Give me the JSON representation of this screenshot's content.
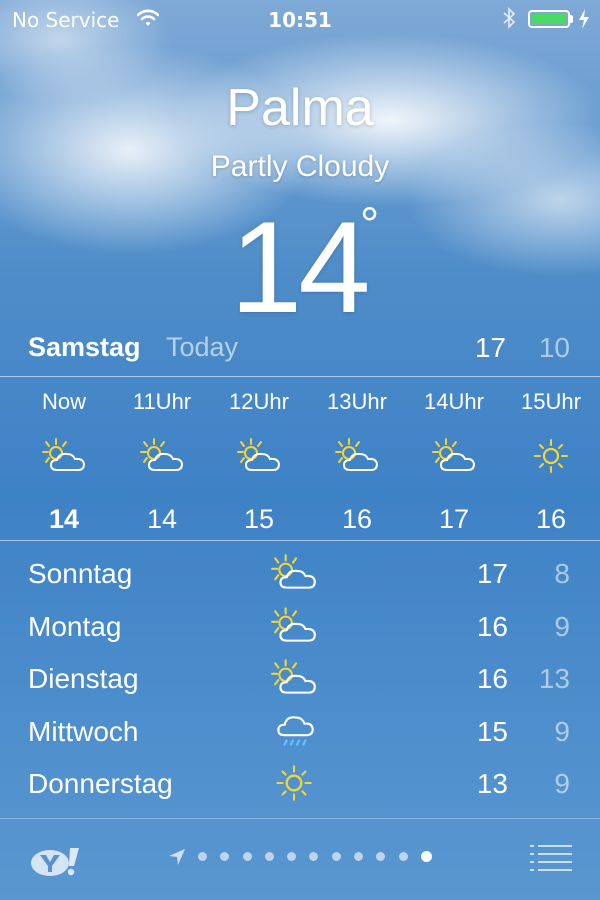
{
  "status_bar": {
    "carrier": "No Service",
    "time": "10:51"
  },
  "header": {
    "city": "Palma",
    "condition": "Partly Cloudy",
    "temperature": "14",
    "degree": "°"
  },
  "today": {
    "day": "Samstag",
    "label": "Today",
    "high": "17",
    "low": "10"
  },
  "hourly": [
    {
      "label": "Now",
      "icon": "partly-cloudy-icon",
      "temp": "14"
    },
    {
      "label": "11Uhr",
      "icon": "partly-cloudy-icon",
      "temp": "14"
    },
    {
      "label": "12Uhr",
      "icon": "partly-cloudy-icon",
      "temp": "15"
    },
    {
      "label": "13Uhr",
      "icon": "partly-cloudy-icon",
      "temp": "16"
    },
    {
      "label": "14Uhr",
      "icon": "partly-cloudy-icon",
      "temp": "17"
    },
    {
      "label": "15Uhr",
      "icon": "sun-icon",
      "temp": "16"
    }
  ],
  "daily": [
    {
      "day": "Sonntag",
      "icon": "partly-cloudy-icon",
      "high": "17",
      "low": "8"
    },
    {
      "day": "Montag",
      "icon": "partly-cloudy-icon",
      "high": "16",
      "low": "9"
    },
    {
      "day": "Dienstag",
      "icon": "partly-cloudy-icon",
      "high": "16",
      "low": "13"
    },
    {
      "day": "Mittwoch",
      "icon": "rain-icon",
      "high": "15",
      "low": "9"
    },
    {
      "day": "Donnerstag",
      "icon": "sun-icon",
      "high": "13",
      "low": "9"
    }
  ],
  "pager": {
    "page_count": 11,
    "active_page": 11
  },
  "colors": {
    "sun": "#f5d533",
    "battery": "#4cd964",
    "sky": "#3e82c6"
  }
}
